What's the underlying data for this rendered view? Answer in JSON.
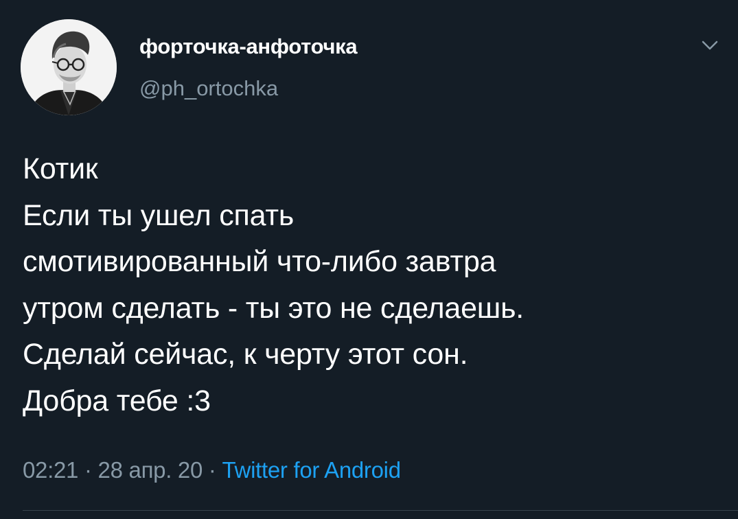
{
  "tweet": {
    "author": {
      "display_name": "форточка-анфоточка",
      "username": "@ph_ortochka"
    },
    "text_lines": [
      "Котик",
      "Если ты ушел спать",
      "смотивированный что-либо завтра",
      "утром сделать - ты это не сделаешь.",
      "Сделай сейчас, к черту этот сон.",
      "Добра тебе :3"
    ],
    "time": "02:21",
    "date": "28 апр. 20",
    "separator": "·",
    "source": "Twitter for Android",
    "icons": {
      "menu": "chevron-down-icon",
      "avatar": "avatar"
    },
    "colors": {
      "background": "#141d26",
      "text": "#ffffff",
      "secondary_text": "#8899a6",
      "link": "#1da1f2"
    }
  }
}
